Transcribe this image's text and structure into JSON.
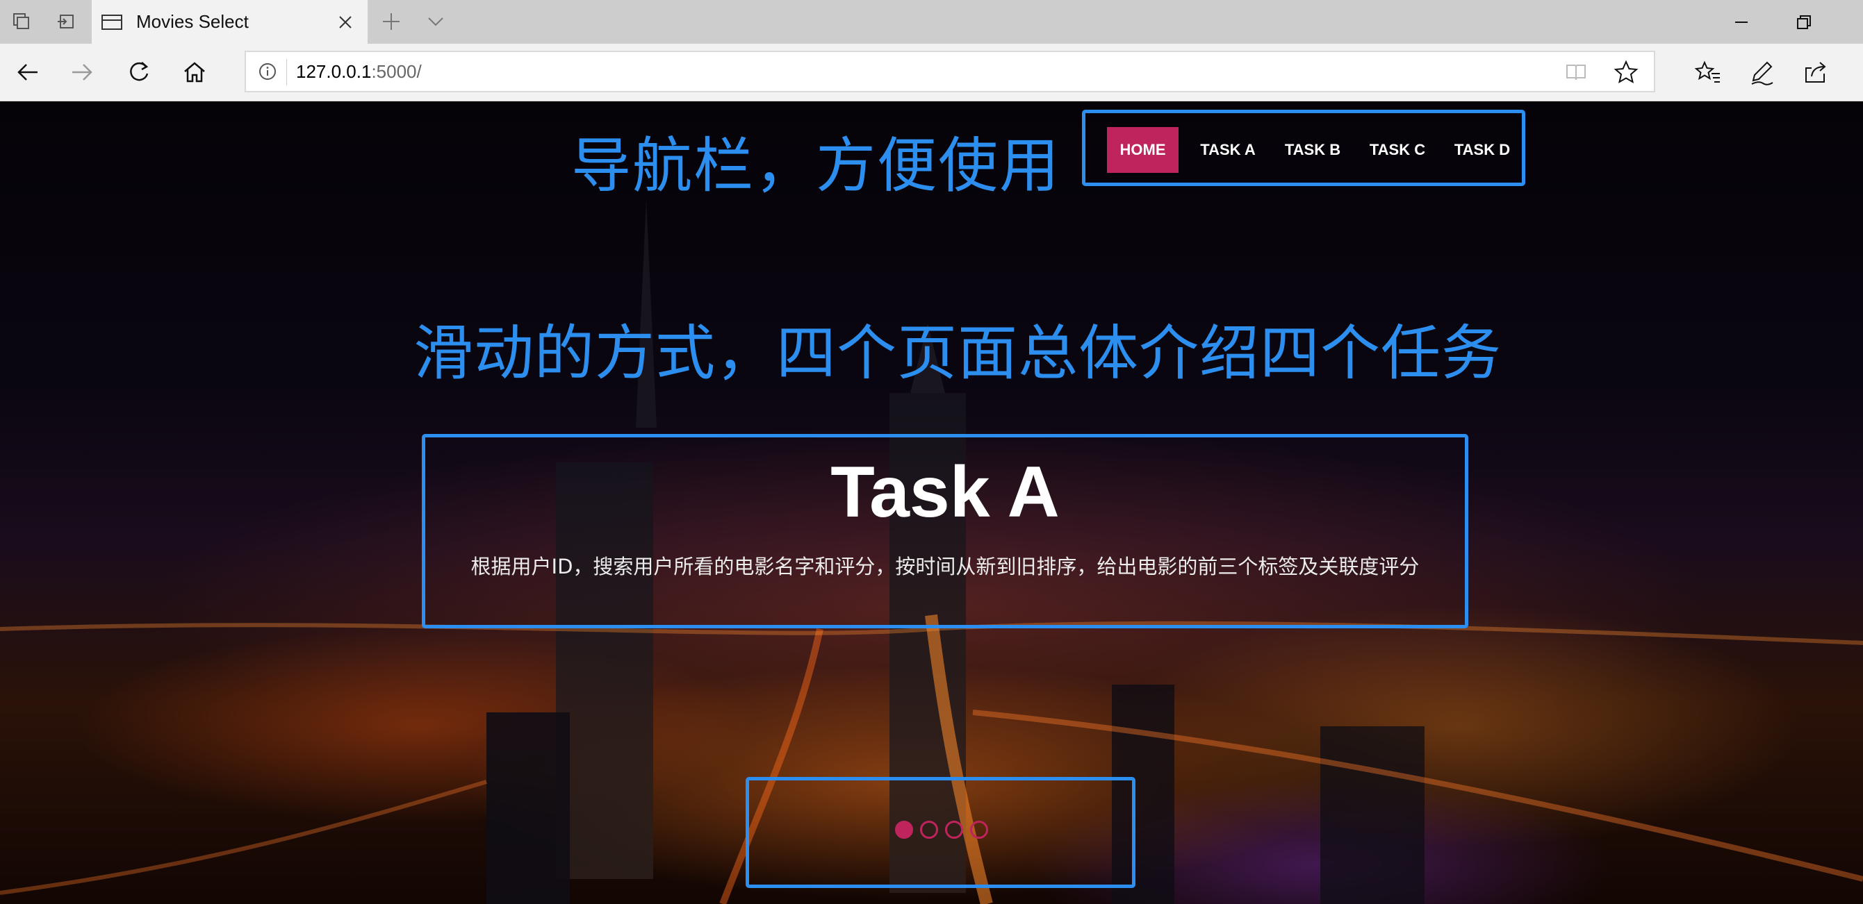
{
  "browser": {
    "tab_title": "Movies Select",
    "url_host": "127.0.0.1",
    "url_port": ":5000/"
  },
  "annotations": {
    "nav_note": "导航栏，方便使用",
    "slide_note": "滑动的方式，四个页面总体介绍四个任务"
  },
  "nav": {
    "items": [
      {
        "label": "HOME",
        "active": true
      },
      {
        "label": "TASK A",
        "active": false
      },
      {
        "label": "TASK B",
        "active": false
      },
      {
        "label": "TASK C",
        "active": false
      },
      {
        "label": "TASK D",
        "active": false
      }
    ]
  },
  "slide": {
    "title": "Task A",
    "description": "根据用户ID，搜索用户所看的电影名字和评分，按时间从新到旧排序，给出电影的前三个标签及关联度评分",
    "indicator_count": 4,
    "active_index": 0
  },
  "colors": {
    "accent": "#c0245c",
    "annotation": "#2c8ff0"
  }
}
